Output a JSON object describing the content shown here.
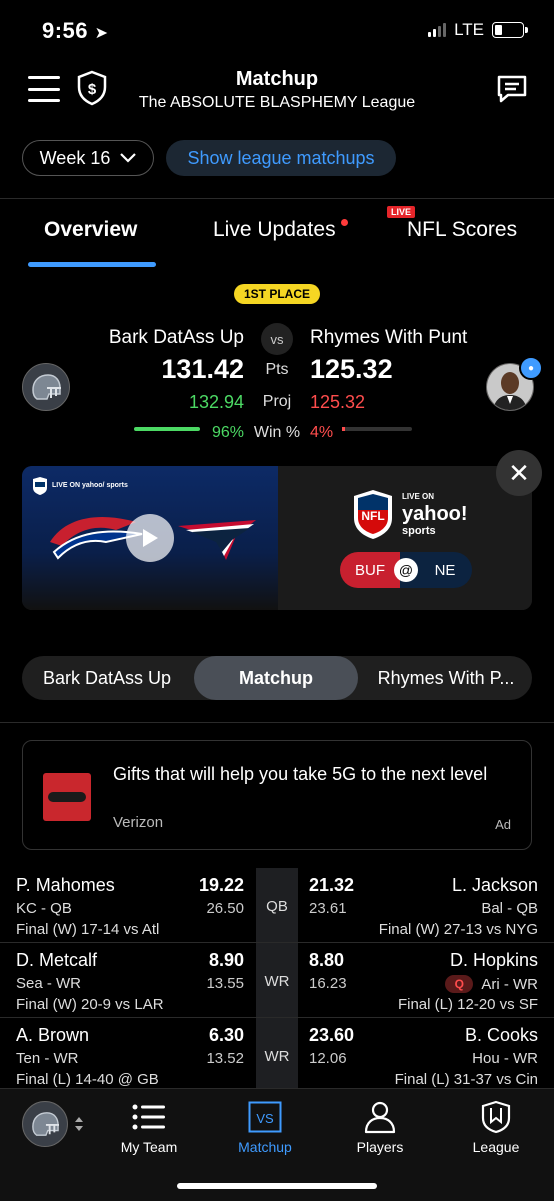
{
  "status": {
    "time": "9:56",
    "network": "LTE"
  },
  "header": {
    "title": "Matchup",
    "subtitle": "The ABSOLUTE BLASPHEMY League"
  },
  "week": {
    "label": "Week 16"
  },
  "show_league": "Show league matchups",
  "tabs": [
    {
      "label": "Overview",
      "active": true
    },
    {
      "label": "Live Updates",
      "dot": true
    },
    {
      "label": "NFL Scores",
      "badge": "LIVE"
    }
  ],
  "summary": {
    "place": "1ST PLACE",
    "vs": "vs",
    "left": {
      "team": "Bark DatAss Up",
      "pts": "131.42",
      "proj": "132.94",
      "win": "96%",
      "win_fraction": 0.96
    },
    "right": {
      "team": "Rhymes With Punt",
      "pts": "125.32",
      "proj": "125.32",
      "win": "4%",
      "win_fraction": 0.04
    },
    "labels": {
      "pts": "Pts",
      "proj": "Proj",
      "win": "Win %"
    }
  },
  "video": {
    "brand_small": "LIVE ON yahoo/ sports",
    "brand_live_on": "LIVE ON",
    "brand_yahoo": "yahoo!",
    "brand_sports": "sports",
    "nfl": "NFL",
    "home": "BUF",
    "at": "@",
    "away": "NE",
    "colors": {
      "buf": "#c8202f",
      "ne": "#0c2340"
    }
  },
  "segment": {
    "left": "Bark DatAss Up",
    "center": "Matchup",
    "right": "Rhymes With P..."
  },
  "ad": {
    "text": "Gifts that will help you take 5G to the next level",
    "source": "Verizon",
    "label": "Ad"
  },
  "roster": [
    {
      "lname": "P. Mahomes",
      "lsub": "KC - QB",
      "lgame": "Final (W) 17-14 vs Atl",
      "lpts": "19.22",
      "lproj": "26.50",
      "pos": "QB",
      "rpts": "21.32",
      "rproj": "23.61",
      "rname": "L. Jackson",
      "rsub": "Bal - QB",
      "rgame": "Final (W) 27-13 vs NYG",
      "rbadge": ""
    },
    {
      "lname": "D. Metcalf",
      "lsub": "Sea - WR",
      "lgame": "Final (W) 20-9 vs LAR",
      "lpts": "8.90",
      "lproj": "13.55",
      "pos": "WR",
      "rpts": "8.80",
      "rproj": "16.23",
      "rname": "D. Hopkins",
      "rsub": "Ari - WR",
      "rgame": "Final (L) 12-20 vs SF",
      "rbadge": "Q"
    },
    {
      "lname": "A. Brown",
      "lsub": "Ten - WR",
      "lgame": "Final (L) 14-40 @ GB",
      "lpts": "6.30",
      "lproj": "13.52",
      "pos": "WR",
      "rpts": "23.60",
      "rproj": "12.06",
      "rname": "B. Cooks",
      "rsub": "Hou - WR",
      "rgame": "Final (L) 31-37 vs Cin",
      "rbadge": ""
    }
  ],
  "nav": [
    {
      "label": "My Team",
      "icon": "list-icon"
    },
    {
      "label": "Matchup",
      "icon": "vs-icon",
      "active": true
    },
    {
      "label": "Players",
      "icon": "person-icon"
    },
    {
      "label": "League",
      "icon": "league-shield-icon"
    }
  ],
  "colors": {
    "accent": "#3f9bff",
    "win": "#4cd964",
    "loss": "#ff4d4d"
  }
}
